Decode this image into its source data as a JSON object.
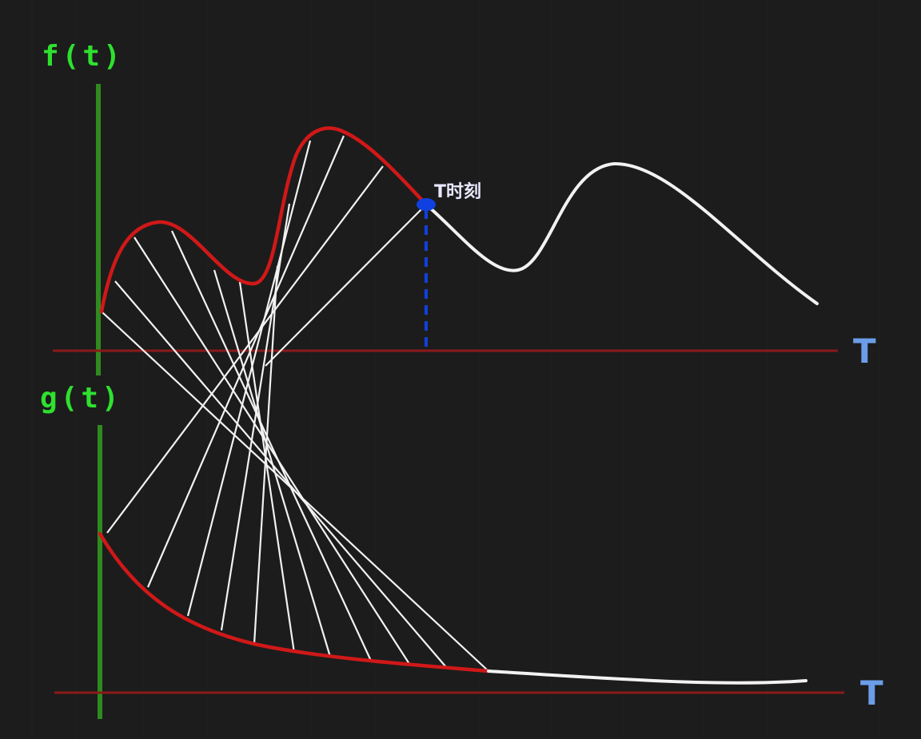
{
  "labels": {
    "f_axis": "f(t)",
    "g_axis": "g(t)",
    "t_axis_top": "T",
    "t_axis_bottom": "T",
    "t_moment": "T时刻"
  },
  "colors": {
    "background": "#1c1c1c",
    "axis_label": "#2fe02f",
    "vertical_axis": "#2f8a1f",
    "horizontal_axis": "#8b1a1a",
    "highlight_curve": "#d01818",
    "curve": "#f2f2f2",
    "marker": "#1040e0",
    "t_label": "#6b9ee8"
  }
}
